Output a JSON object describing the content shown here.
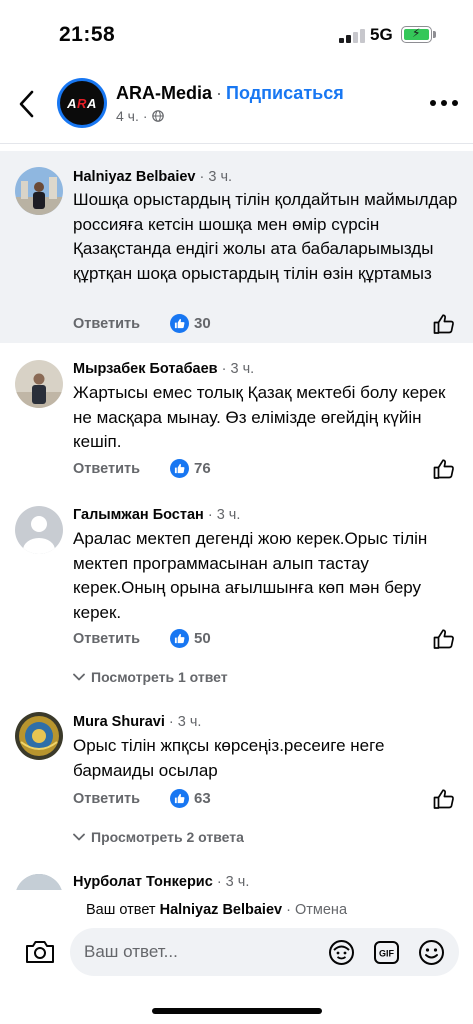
{
  "status_bar": {
    "time": "21:58",
    "network": "5G"
  },
  "header": {
    "page_name": "ARA-Media",
    "separator": "·",
    "subscribe_label": "Подписаться",
    "post_time": "4 ч.",
    "meta_separator": "·",
    "logo_text_a": "A",
    "logo_text_r": "R",
    "logo_text_a2": "A",
    "icons": [
      "back-chevron-icon",
      "globe-icon",
      "more-icon"
    ]
  },
  "comments": [
    {
      "author": "Halniyaz Belbaiev",
      "time": "· 3 ч.",
      "text": "Шошқа орыстардың тілін қолдайтын маймылдар россияға кетсін шошқа мен өмір сүрсін Қазақстанда ендігі жолы ата бабаларымызды құртқан шоқа орыстардың тілін өзін құртамыз",
      "reply_label": "Ответить",
      "likes": "30",
      "highlighted": true
    },
    {
      "author": "Мырзабек Ботабаев",
      "time": "· 3 ч.",
      "text": "Жартысы емес  толық Қазақ мектебі болу керек не масқара мынау. Өз елімізде өгейдің күйін кешіп.",
      "reply_label": "Ответить",
      "likes": "76"
    },
    {
      "author": "Галымжан Бостан",
      "time": "· 3 ч.",
      "text": "Аралас мектеп дегенді жою керек.Орыс тілін мектеп программасынан алып тастау керек.Оның орына ағылшынға көп мән беру керек.",
      "reply_label": "Ответить",
      "likes": "50",
      "view_replies": "Посмотреть 1 ответ"
    },
    {
      "author": "Mura Shuravi",
      "time": "· 3 ч.",
      "text": "Орыс тілін жпқсы көрсеңіз.ресеиге неге бармаиды осылар",
      "reply_label": "Ответить",
      "likes": "63",
      "view_replies": "Просмотреть 2 ответа"
    },
    {
      "author": "Нурболат Тонкерис",
      "time": "· 3 ч."
    }
  ],
  "composer": {
    "reply_prefix": "Ваш ответ",
    "reply_to": "Halniyaz Belbaiev",
    "cancel_label": "· Отмена",
    "placeholder": "Ваш ответ...",
    "gif_label": "GIF",
    "icons": [
      "camera-icon",
      "avatar-sticker-icon",
      "gif-icon",
      "emoji-icon"
    ]
  },
  "colors": {
    "accent": "#1877f2",
    "secondary_text": "#65676b",
    "highlight_bg": "#f0f2f5"
  }
}
